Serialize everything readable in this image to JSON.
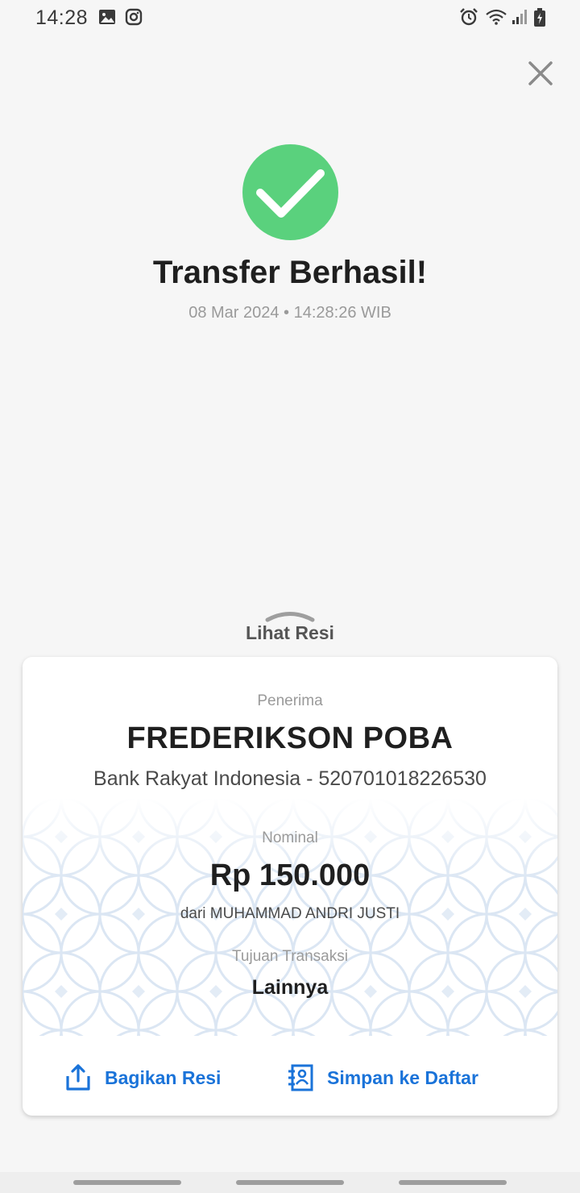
{
  "status_bar": {
    "time": "14:28",
    "left_icons": [
      "gallery-icon",
      "instagram-icon"
    ],
    "right_icons": [
      "alarm-icon",
      "wifi-icon",
      "signal-icon",
      "battery-charging-icon"
    ]
  },
  "header": {
    "close_icon": "close-icon"
  },
  "success": {
    "icon": "check-circle-icon",
    "icon_color": "#5ad17d",
    "title": "Transfer Berhasil!",
    "datetime": "08 Mar 2024 • 14:28:26 WIB"
  },
  "receipt_toggle": {
    "label": "Lihat Resi",
    "icon": "chevron-up-icon"
  },
  "receipt": {
    "recipient_label": "Penerima",
    "recipient_name": "FREDERIKSON POBA",
    "recipient_bank": "Bank Rakyat Indonesia - 520701018226530",
    "amount_label": "Nominal",
    "amount": "Rp 150.000",
    "sender": "dari MUHAMMAD ANDRI JUSTI",
    "purpose_label": "Tujuan Transaksi",
    "purpose": "Lainnya"
  },
  "actions": {
    "share_label": "Bagikan Resi",
    "save_label": "Simpan ke Daftar",
    "accent_color": "#1a73d9"
  }
}
